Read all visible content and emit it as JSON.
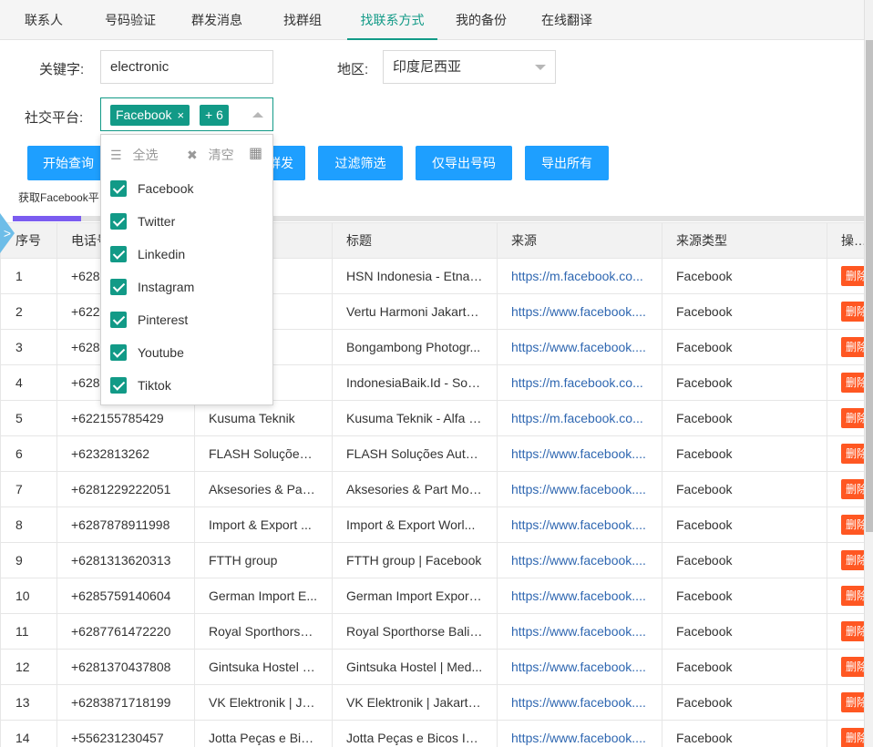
{
  "tabs": [
    {
      "label": "联系人"
    },
    {
      "label": "号码验证"
    },
    {
      "label": "群发消息"
    },
    {
      "label": "找群组"
    },
    {
      "label": "找联系方式"
    },
    {
      "label": "我的备份"
    },
    {
      "label": "在线翻译"
    }
  ],
  "active_tab": "找联系方式",
  "form": {
    "keyword_label": "关键字:",
    "keyword_value": "electronic",
    "region_label": "地区:",
    "region_value": "印度尼西亚",
    "platform_label": "社交平台:",
    "platform_chip": "Facebook",
    "platform_chip_close": "×",
    "platform_more": "+ 6"
  },
  "dropdown": {
    "select_all": "全选",
    "clear": "清空",
    "items": [
      {
        "label": "Facebook",
        "checked": true
      },
      {
        "label": "Twitter",
        "checked": true
      },
      {
        "label": "Linkedin",
        "checked": true
      },
      {
        "label": "Instagram",
        "checked": true
      },
      {
        "label": "Pinterest",
        "checked": true
      },
      {
        "label": "Youtube",
        "checked": true
      },
      {
        "label": "Tiktok",
        "checked": true
      }
    ]
  },
  "buttons": {
    "start": "开始查询",
    "bulk_partial": "群发",
    "filter": "过滤筛选",
    "export_numbers": "仅导出号码",
    "export_all": "导出所有"
  },
  "hint": "获取Facebook平台",
  "colors": {
    "accent": "#129a87",
    "button": "#1e9fff",
    "delete": "#ff5722",
    "link": "#2f67b1"
  },
  "table": {
    "columns": [
      "序号",
      "电话号码",
      "名称",
      "标题",
      "来源",
      "来源类型",
      "操作"
    ],
    "delete_label": "删除",
    "rows": [
      {
        "no": "1",
        "phone": "+628",
        "name": "esia",
        "title": "HSN Indonesia - Etna ...",
        "source": "https://m.facebook.co...",
        "type": "Facebook"
      },
      {
        "no": "2",
        "phone": "+622",
        "name": "oni Ja...",
        "title": "Vertu Harmoni Jakarta...",
        "source": "https://www.facebook....",
        "type": "Facebook"
      },
      {
        "no": "3",
        "phone": "+628",
        "name": "ng Ph...",
        "title": "Bongambong Photogr...",
        "source": "https://www.facebook....",
        "type": "Facebook"
      },
      {
        "no": "4",
        "phone": "+628",
        "name": "aik.Id",
        "title": "IndonesiaBaik.Id - Soh...",
        "source": "https://m.facebook.co...",
        "type": "Facebook"
      },
      {
        "no": "5",
        "phone": "+622155785429",
        "name": "Kusuma Teknik",
        "title": "Kusuma Teknik - Alfa L...",
        "source": "https://m.facebook.co...",
        "type": "Facebook"
      },
      {
        "no": "6",
        "phone": "+6232813262",
        "name": "FLASH Soluções ...",
        "title": "FLASH Soluções Auto...",
        "source": "https://www.facebook....",
        "type": "Facebook"
      },
      {
        "no": "7",
        "phone": "+6281229222051",
        "name": "Aksesories & Part...",
        "title": "Aksesories & Part Mot...",
        "source": "https://www.facebook....",
        "type": "Facebook"
      },
      {
        "no": "8",
        "phone": "+6287878911998",
        "name": "Import & Export ...",
        "title": "Import & Export Worl...",
        "source": "https://www.facebook....",
        "type": "Facebook"
      },
      {
        "no": "9",
        "phone": "+6281313620313",
        "name": "FTTH group",
        "title": "FTTH group | Facebook",
        "source": "https://www.facebook....",
        "type": "Facebook"
      },
      {
        "no": "10",
        "phone": "+6285759140604",
        "name": "German Import E...",
        "title": "German Import Export...",
        "source": "https://www.facebook....",
        "type": "Facebook"
      },
      {
        "no": "11",
        "phone": "+6287761472220",
        "name": "Royal Sporthorse ...",
        "title": "Royal Sporthorse Bali |...",
        "source": "https://www.facebook....",
        "type": "Facebook"
      },
      {
        "no": "12",
        "phone": "+6281370437808",
        "name": "Gintsuka Hostel | ...",
        "title": "Gintsuka Hostel | Med...",
        "source": "https://www.facebook....",
        "type": "Facebook"
      },
      {
        "no": "13",
        "phone": "+6283871718199",
        "name": "VK Elektronik | Ja...",
        "title": "VK Elektronik | Jakarta ...",
        "source": "https://www.facebook....",
        "type": "Facebook"
      },
      {
        "no": "14",
        "phone": "+556231230457",
        "name": "Jotta Peças e Bico...",
        "title": "Jotta Peças e Bicos Inj...",
        "source": "https://www.facebook....",
        "type": "Facebook"
      }
    ]
  }
}
